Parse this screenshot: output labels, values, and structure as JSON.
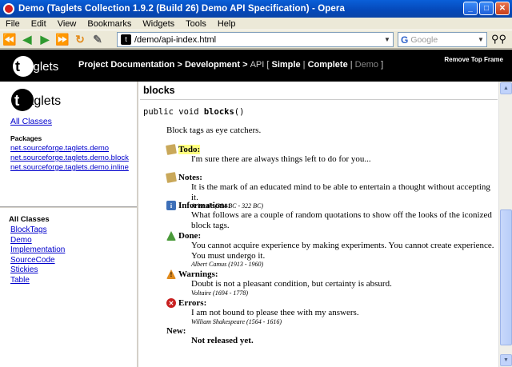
{
  "window": {
    "title": "Demo (Taglets Collection 1.9.2 (Build 26) Demo API Specification) - Opera"
  },
  "menu": [
    "File",
    "Edit",
    "View",
    "Bookmarks",
    "Widgets",
    "Tools",
    "Help"
  ],
  "toolbar": {
    "url": "/demo/api-index.html",
    "search_placeholder": "Google",
    "search_brand": "G"
  },
  "banner": {
    "logo_text": "taglets",
    "crumb_1": "Project Documentation",
    "crumb_sep": " > ",
    "crumb_2": "Development",
    "crumb_3": "API",
    "bracket_open": "[ ",
    "link_simple": "Simple",
    "pipe": " | ",
    "link_complete": "Complete",
    "link_demo": "Demo",
    "bracket_close": " ]",
    "remove_label": "Remove Top Frame"
  },
  "left": {
    "logo_text": "taglets",
    "all_classes_link": "All Classes",
    "packages_heading": "Packages",
    "packages": [
      "net.sourceforge.taglets.demo",
      "net.sourceforge.taglets.demo.block",
      "net.sourceforge.taglets.demo.inline"
    ],
    "classes_heading": "All Classes",
    "classes": [
      "BlockTags",
      "Demo",
      "Implementation",
      "SourceCode",
      "Stickies",
      "Table"
    ]
  },
  "content": {
    "method_heading": "blocks",
    "signature_prefix": "public void ",
    "signature_name": "blocks",
    "signature_suffix": "()",
    "description": "Block tags as eye catchers.",
    "todo_label": "Todo:",
    "todo_body": "I'm sure there are always things left to do for you...",
    "notes_label": "Notes:",
    "notes_body": "It is the mark of an educated mind to be able to entertain a thought without accepting it.",
    "notes_attr": "Aristotle (384 BC - 322 BC)",
    "info_label": "Informations:",
    "info_body": "What follows are a couple of random quotations to show off the looks of the iconized block tags.",
    "done_label": "Done:",
    "done_body": "You cannot acquire experience by making experiments. You cannot create experience. You must undergo it.",
    "done_attr": "Albert Camus (1913 - 1960)",
    "warn_label": "Warnings:",
    "warn_body": "Doubt is not a pleasant condition, but certainty is absurd.",
    "warn_attr": "Voltaire (1694 - 1778)",
    "err_label": "Errors:",
    "err_body": "I am not bound to please thee with my answers.",
    "err_attr": "William Shakespeare (1564 - 1616)",
    "new_label": "New:",
    "new_body": "Not released yet."
  }
}
